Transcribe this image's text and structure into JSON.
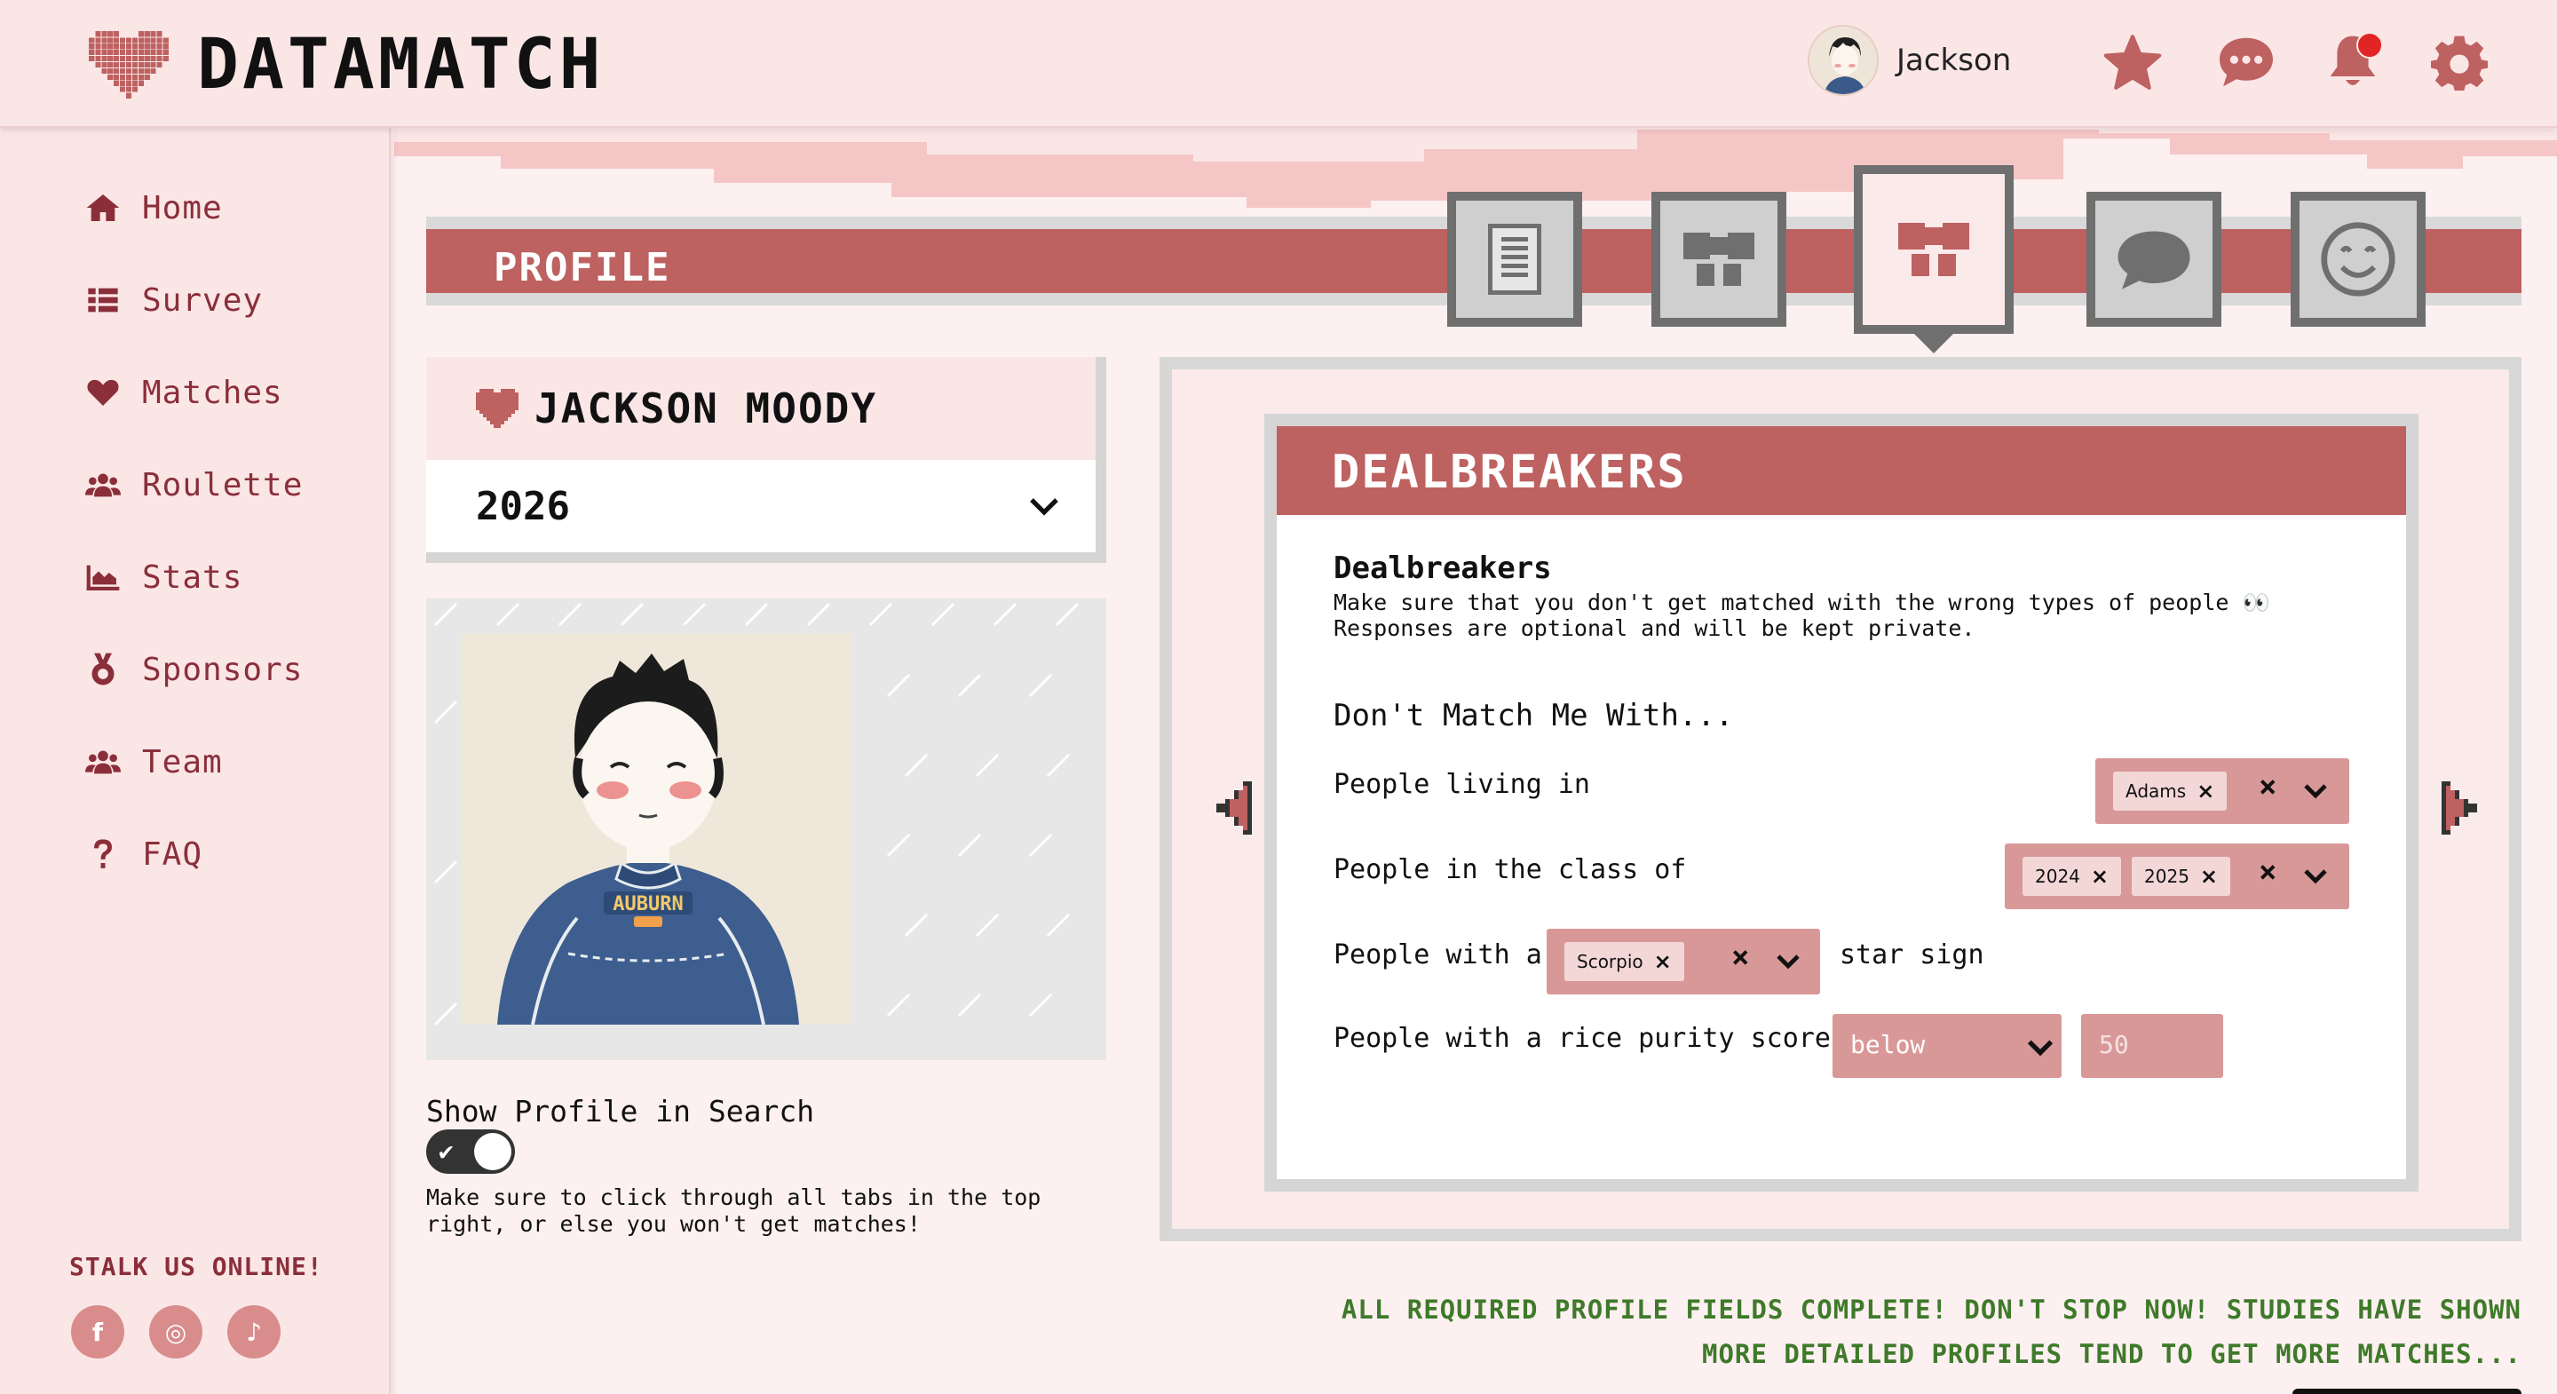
{
  "header": {
    "brand": "DATAMATCH",
    "user_name": "Jackson",
    "icons": [
      "star-icon",
      "chat-icon",
      "bell-icon",
      "gear-icon"
    ]
  },
  "sidebar": {
    "items": [
      {
        "label": "Home",
        "icon": "home-icon"
      },
      {
        "label": "Survey",
        "icon": "list-icon"
      },
      {
        "label": "Matches",
        "icon": "heart-icon"
      },
      {
        "label": "Roulette",
        "icon": "users-icon"
      },
      {
        "label": "Stats",
        "icon": "chart-icon"
      },
      {
        "label": "Sponsors",
        "icon": "medal-icon"
      },
      {
        "label": "Team",
        "icon": "users-icon"
      },
      {
        "label": "FAQ",
        "icon": "question-icon"
      }
    ],
    "stalk_label": "STALK US ONLINE!",
    "socials": [
      {
        "label": "f",
        "icon": "facebook-icon"
      },
      {
        "label": "◎",
        "icon": "instagram-icon"
      },
      {
        "label": "♪",
        "icon": "tiktok-icon"
      }
    ]
  },
  "profile": {
    "section_title": "PROFILE",
    "name": "JACKSON MOODY",
    "class_year": "2026",
    "show_profile_label": "Show Profile in Search",
    "show_profile_enabled": true,
    "toggle_note": "Make sure to click through all tabs in the top right, or else you won't get matches!"
  },
  "tabs": [
    {
      "name": "document-tab",
      "icon": "document-icon",
      "active": false
    },
    {
      "name": "bow-tab",
      "icon": "bow-icon",
      "active": false
    },
    {
      "name": "dealbreakers-tab",
      "icon": "bow-icon",
      "active": true
    },
    {
      "name": "chat-tab",
      "icon": "speech-bubble-icon",
      "active": false
    },
    {
      "name": "smiley-tab",
      "icon": "smiley-icon",
      "active": false
    }
  ],
  "dealbreakers": {
    "header": "DEALBREAKERS",
    "title": "Dealbreakers",
    "description": "Make sure that you don't get matched with the wrong types of people 👀",
    "description2": "Responses are optional and will be kept private.",
    "subtitle": "Don't Match Me With...",
    "rows": {
      "living": {
        "label": "People living in",
        "chips": [
          "Adams"
        ]
      },
      "class": {
        "label": "People in the class of",
        "chips": [
          "2024",
          "2025"
        ]
      },
      "star": {
        "label_before": "People with a",
        "chips": [
          "Scorpio"
        ],
        "label_after": "star sign"
      },
      "rice": {
        "label": "People with a rice purity score",
        "comparison": "below",
        "score_placeholder": "50"
      }
    }
  },
  "status_message": {
    "line1": "ALL REQUIRED PROFILE FIELDS COMPLETE! DON'T STOP NOW! STUDIES HAVE SHOWN",
    "line2": "MORE DETAILED PROFILES TEND TO GET MORE MATCHES..."
  },
  "colors": {
    "accent": "#be6161",
    "nav_text": "#8a2f3a",
    "panel_bg": "#fbeaea",
    "success": "#3e7a2a",
    "select_bg": "#d99898"
  }
}
